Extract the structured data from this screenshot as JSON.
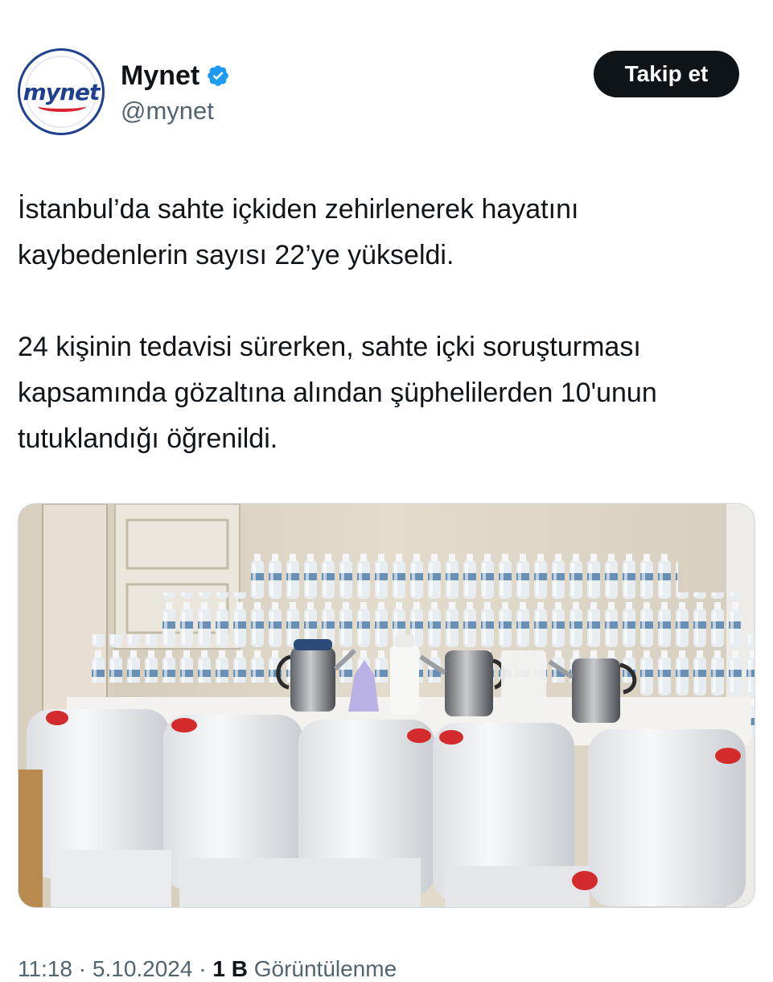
{
  "account": {
    "display_name": "Mynet",
    "handle": "@mynet",
    "avatar_logo_text": "mynet",
    "verified_icon": "verified-badge-icon",
    "brand_color": "#1f3f8f",
    "accent_color": "#d9232e"
  },
  "follow_button": {
    "label": "Takip et"
  },
  "tweet": {
    "paragraph_1": "İstanbul’da sahte içkiden zehirlenerek hayatını kaybedenlerin sayısı 22’ye yükseldi.",
    "paragraph_2": "24 kişinin tedavisi sürerken, sahte içki soruşturması kapsamında gözaltına alından şüphelilerden 10'unun tutuklandığı öğrenildi."
  },
  "media": {
    "kind": "photo"
  },
  "footer": {
    "time": "11:18",
    "separator": "·",
    "date": "5.10.2024",
    "views_count": "1 B",
    "views_label": "Görüntülenme"
  }
}
